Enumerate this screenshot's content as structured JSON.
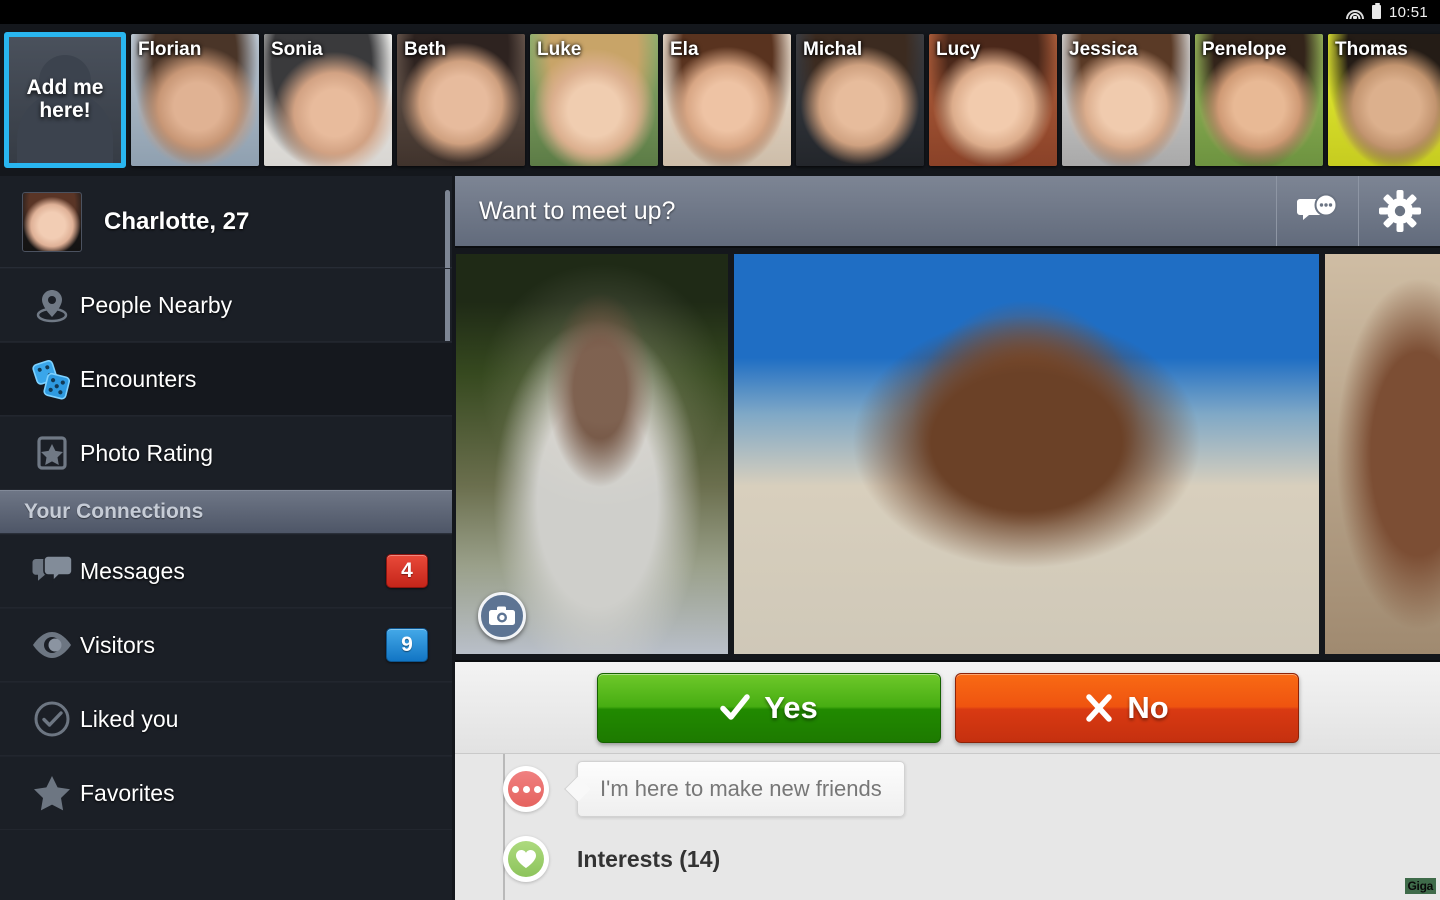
{
  "statusbar": {
    "time": "10:51",
    "wifi_icon": "wifi-icon",
    "battery_icon": "battery-icon"
  },
  "photostrip": {
    "add_me": {
      "line1": "Add me",
      "line2": "here!",
      "highlight_color": "#29b6f0"
    },
    "people": [
      {
        "name": "Florian"
      },
      {
        "name": "Sonia"
      },
      {
        "name": "Beth"
      },
      {
        "name": "Luke"
      },
      {
        "name": "Ela"
      },
      {
        "name": "Michal"
      },
      {
        "name": "Lucy"
      },
      {
        "name": "Jessica"
      },
      {
        "name": "Penelope"
      },
      {
        "name": "Thomas"
      }
    ]
  },
  "sidebar": {
    "profile": {
      "name_age": "Charlotte, 27",
      "avatar_icon": "user-avatar"
    },
    "items": [
      {
        "label": "People Nearby",
        "icon": "location-pin-icon",
        "badge": "",
        "active": false
      },
      {
        "label": "Encounters",
        "icon": "dice-icon",
        "badge": "",
        "active": true
      },
      {
        "label": "Photo Rating",
        "icon": "star-frame-icon",
        "badge": "",
        "active": false
      }
    ],
    "section_header": "Your Connections",
    "connections": [
      {
        "label": "Messages",
        "icon": "chat-bubbles-icon",
        "badge": "4",
        "badge_color": "#d32d1f"
      },
      {
        "label": "Visitors",
        "icon": "eye-icon",
        "badge": "9",
        "badge_color": "#1a86d4"
      },
      {
        "label": "Liked you",
        "icon": "check-circle-icon",
        "badge": "",
        "badge_color": ""
      },
      {
        "label": "Favorites",
        "icon": "star-icon",
        "badge": "",
        "badge_color": ""
      }
    ]
  },
  "main": {
    "header": {
      "title": "Want to meet up?",
      "chat_icon": "chat-icon",
      "settings_icon": "gear-icon"
    },
    "photos": [
      {
        "alt": "man-in-gray-henley-outdoors",
        "camera_badge": "camera-icon"
      },
      {
        "alt": "smiling-man-selfie-boardwalk"
      },
      {
        "alt": "man-ear-closeup-stone-wall"
      }
    ],
    "vote": {
      "yes_label": "Yes",
      "no_label": "No",
      "yes_color": "#2e9a0b",
      "no_color": "#e14410"
    },
    "timeline": [
      {
        "type": "quote",
        "icon": "dots-icon",
        "text": "I'm here to make new friends"
      },
      {
        "type": "interests",
        "icon": "heart-icon",
        "text": "Interests (14)"
      }
    ]
  },
  "watermark": {
    "text": "Giga"
  }
}
